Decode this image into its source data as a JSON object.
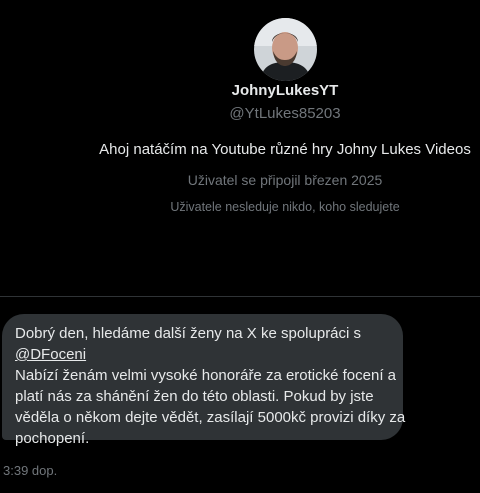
{
  "profile": {
    "display_name": "JohnyLukesYT",
    "handle": "@YtLukes85203",
    "bio": "Ahoj natáčím na Youtube různé hry Johny Lukes Videos",
    "joined": "Uživatel se připojil březen 2025",
    "mutual_followers": "Uživatele nesleduje nikdo, koho sledujete"
  },
  "message": {
    "line1": "Dobrý den, hledáme další ženy na X ke spolupráci s",
    "mention": "@DFoceni",
    "line3": " Nabízí ženám velmi vysoké honoráře za erotické focení a",
    "line4": "platí nás za shánění žen do této oblasti. Pokud by jste",
    "line5": "věděla o někom dejte vědět, zasílají 5000kč provizi díky za",
    "line6": "pochopení.",
    "timestamp": "3:39 dop."
  }
}
